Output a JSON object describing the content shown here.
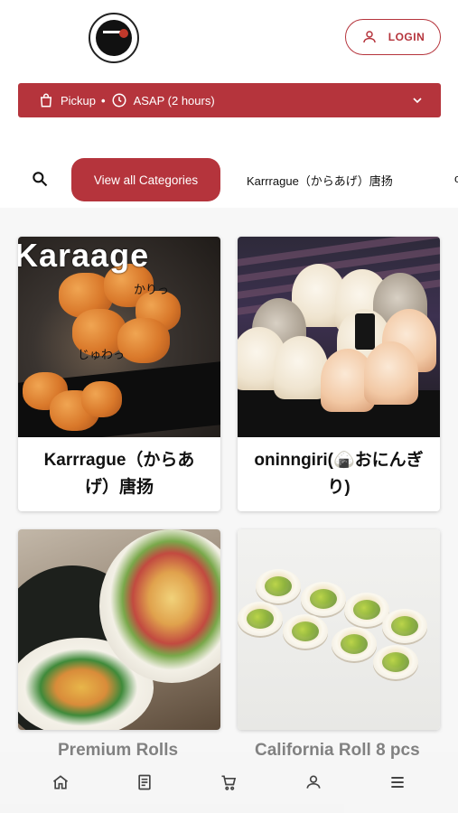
{
  "header": {
    "logo_alt": "store logo",
    "login_label": "LOGIN"
  },
  "order_bar": {
    "mode_label": "Pickup",
    "separator": "•",
    "time_label": "ASAP (2 hours)"
  },
  "categories": {
    "active_label": "View all Categories",
    "items": [
      {
        "label": "Karrrague（からあげ）唐扬"
      }
    ],
    "more_label": "o"
  },
  "products": [
    {
      "name": "Karrrague（からあげ）唐扬",
      "image_caption": "Karaage",
      "overlay_text_1": "かりっ",
      "overlay_text_2": "じゅわっ"
    },
    {
      "name": "oninngiri(🍙おにんぎり)"
    },
    {
      "name": "Premium Rolls"
    },
    {
      "name": "California Roll 8 pcs"
    }
  ],
  "bottom_nav": [
    {
      "icon": "home-icon"
    },
    {
      "icon": "menu-book-icon"
    },
    {
      "icon": "cart-icon"
    },
    {
      "icon": "account-icon"
    },
    {
      "icon": "hamburger-menu-icon"
    }
  ],
  "colors": {
    "brand": "#b5343c"
  }
}
